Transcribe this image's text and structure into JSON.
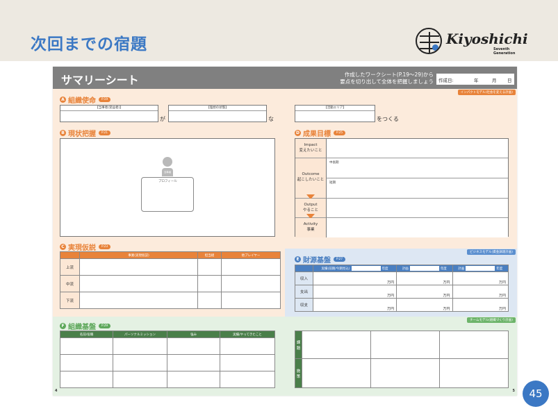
{
  "slide": {
    "title": "次回までの宿題",
    "page_number": "45"
  },
  "logo": {
    "word": "Kiyoshichi",
    "sub": "Seventh Generation"
  },
  "sheet": {
    "title": "サマリーシート",
    "note_line1": "作成したワークシート(P.19～29)から",
    "note_line2": "要点を切り出して全体を把握しましょう",
    "date_label": "作成日:",
    "date_year": "年",
    "date_month": "月",
    "date_day": "日",
    "page_left": "4",
    "page_right": "5"
  },
  "model_tags": {
    "impact": "インパクトモデル(社会を変える計画)",
    "business": "ビジネスモデル(資金調達計画)",
    "team": "チームモデル(組織づくり計画)"
  },
  "sections": {
    "a": {
      "letter": "A",
      "label": "組織使命",
      "page": "P.19"
    },
    "b": {
      "letter": "B",
      "label": "現状把握",
      "page": "P.21"
    },
    "c": {
      "letter": "C",
      "label": "実現仮説",
      "page": "P.23"
    },
    "d": {
      "letter": "D",
      "label": "成果目標",
      "page": "P.25"
    },
    "e": {
      "letter": "E",
      "label": "財源基盤",
      "page": "P.27"
    },
    "f": {
      "letter": "F",
      "label": "組織基盤",
      "page": "P.29"
    }
  },
  "mission": {
    "field1": "【当事者(受益者)】",
    "joiner1": "が",
    "field2": "【理想の状態】",
    "joiner2": "な",
    "field3": "【活動エリア】",
    "joiner3": "をつくる"
  },
  "situation": {
    "person_label": "当事者",
    "profile_label": "プロフィール"
  },
  "goals": {
    "rows": [
      {
        "en": "Impact",
        "jp": "変えたいこと",
        "note": ""
      },
      {
        "en": "Outcome",
        "jp": "起こしたいこと",
        "note": "中長期"
      },
      {
        "en": "",
        "jp": "",
        "note": "短期"
      },
      {
        "en": "Output",
        "jp": "やること",
        "note": ""
      },
      {
        "en": "Activity",
        "jp": "事業",
        "note": ""
      }
    ]
  },
  "hypothesis": {
    "headers": [
      "事業(実現仮説)",
      "担当組",
      "他プレイヤー"
    ],
    "rows": [
      "上流",
      "中流",
      "下流"
    ]
  },
  "finance": {
    "headers": [
      "実績(前期/今期見込)",
      "年度",
      "計画",
      "年度",
      "計画",
      "年度"
    ],
    "rows": [
      "収入",
      "支出",
      "収支"
    ],
    "unit": "万円"
  },
  "org": {
    "headers": [
      "名前/役職",
      "パーソナルミッション",
      "強み",
      "実績/やってきたこと"
    ],
    "side_labels": [
      "課題",
      "施策"
    ]
  }
}
